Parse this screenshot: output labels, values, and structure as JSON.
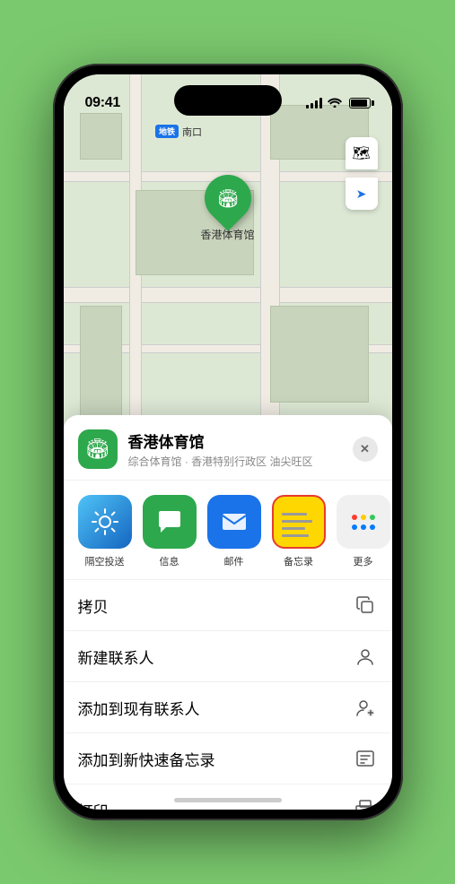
{
  "status_bar": {
    "time": "09:41",
    "location_arrow": "▶"
  },
  "map": {
    "subway_badge": "地铁",
    "exit_label": "南口",
    "pin_label": "香港体育馆",
    "pin_emoji": "🏟"
  },
  "map_controls": {
    "map_icon": "🗺",
    "location_icon": "➤"
  },
  "venue": {
    "name": "香港体育馆",
    "description": "综合体育馆 · 香港特别行政区 油尖旺区",
    "icon_emoji": "🏟"
  },
  "share_apps": [
    {
      "id": "airdrop",
      "label": "隔空投送",
      "type": "airdrop"
    },
    {
      "id": "messages",
      "label": "信息",
      "type": "messages"
    },
    {
      "id": "mail",
      "label": "邮件",
      "type": "mail"
    },
    {
      "id": "notes",
      "label": "备忘录",
      "type": "notes"
    }
  ],
  "actions": [
    {
      "id": "copy",
      "label": "拷贝",
      "icon": "copy"
    },
    {
      "id": "new-contact",
      "label": "新建联系人",
      "icon": "person"
    },
    {
      "id": "add-contact",
      "label": "添加到现有联系人",
      "icon": "person-add"
    },
    {
      "id": "quick-note",
      "label": "添加到新快速备忘录",
      "icon": "note"
    },
    {
      "id": "print",
      "label": "打印",
      "icon": "print"
    }
  ],
  "close_label": "✕",
  "home_bar": ""
}
